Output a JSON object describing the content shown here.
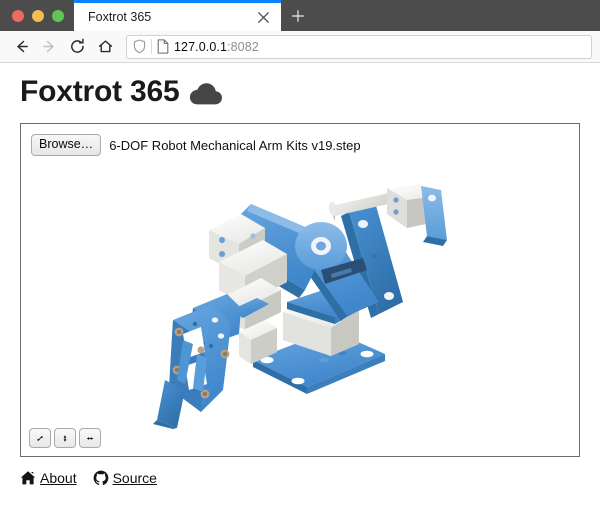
{
  "browser": {
    "window_controls": [
      "close",
      "minimize",
      "maximize"
    ],
    "tab": {
      "title": "Foxtrot 365",
      "close_icon": "close-icon",
      "accent_color": "#0a84ff"
    },
    "new_tab_label": "+",
    "nav": {
      "back_icon": "back-arrow-icon",
      "forward_icon": "forward-arrow-icon",
      "reload_icon": "reload-icon",
      "home_icon": "home-icon"
    },
    "url": {
      "host": "127.0.0.1",
      "port": ":8082",
      "shield_icon": "shield-icon",
      "page_icon": "page-document-icon"
    }
  },
  "page": {
    "title": "Foxtrot 365",
    "title_icon": "cloud-icon",
    "file_picker": {
      "browse_label": "Browse…",
      "file_name": "6-DOF Robot Mechanical Arm Kits v19.step"
    },
    "viewer": {
      "model_name": "6-DOF Robot Mechanical Arm Kits v19.step",
      "primary_color": "#4a92d6",
      "shadow_color": "#2f6fa8",
      "highlight_color": "#7fb6e6",
      "metal_color": "#f2f2ef",
      "bolt_color": "#b8a184",
      "toolbar": [
        {
          "name": "fit-diagonal-button",
          "icon": "resize-diagonal-icon",
          "label": "⤡"
        },
        {
          "name": "fit-vertical-button",
          "icon": "resize-vertical-icon",
          "label": "↕"
        },
        {
          "name": "fit-horizontal-button",
          "icon": "resize-horizontal-icon",
          "label": "↔"
        }
      ]
    },
    "footer": {
      "links": [
        {
          "label": "About",
          "icon": "home-icon"
        },
        {
          "label": "Source",
          "icon": "github-icon"
        }
      ]
    }
  }
}
